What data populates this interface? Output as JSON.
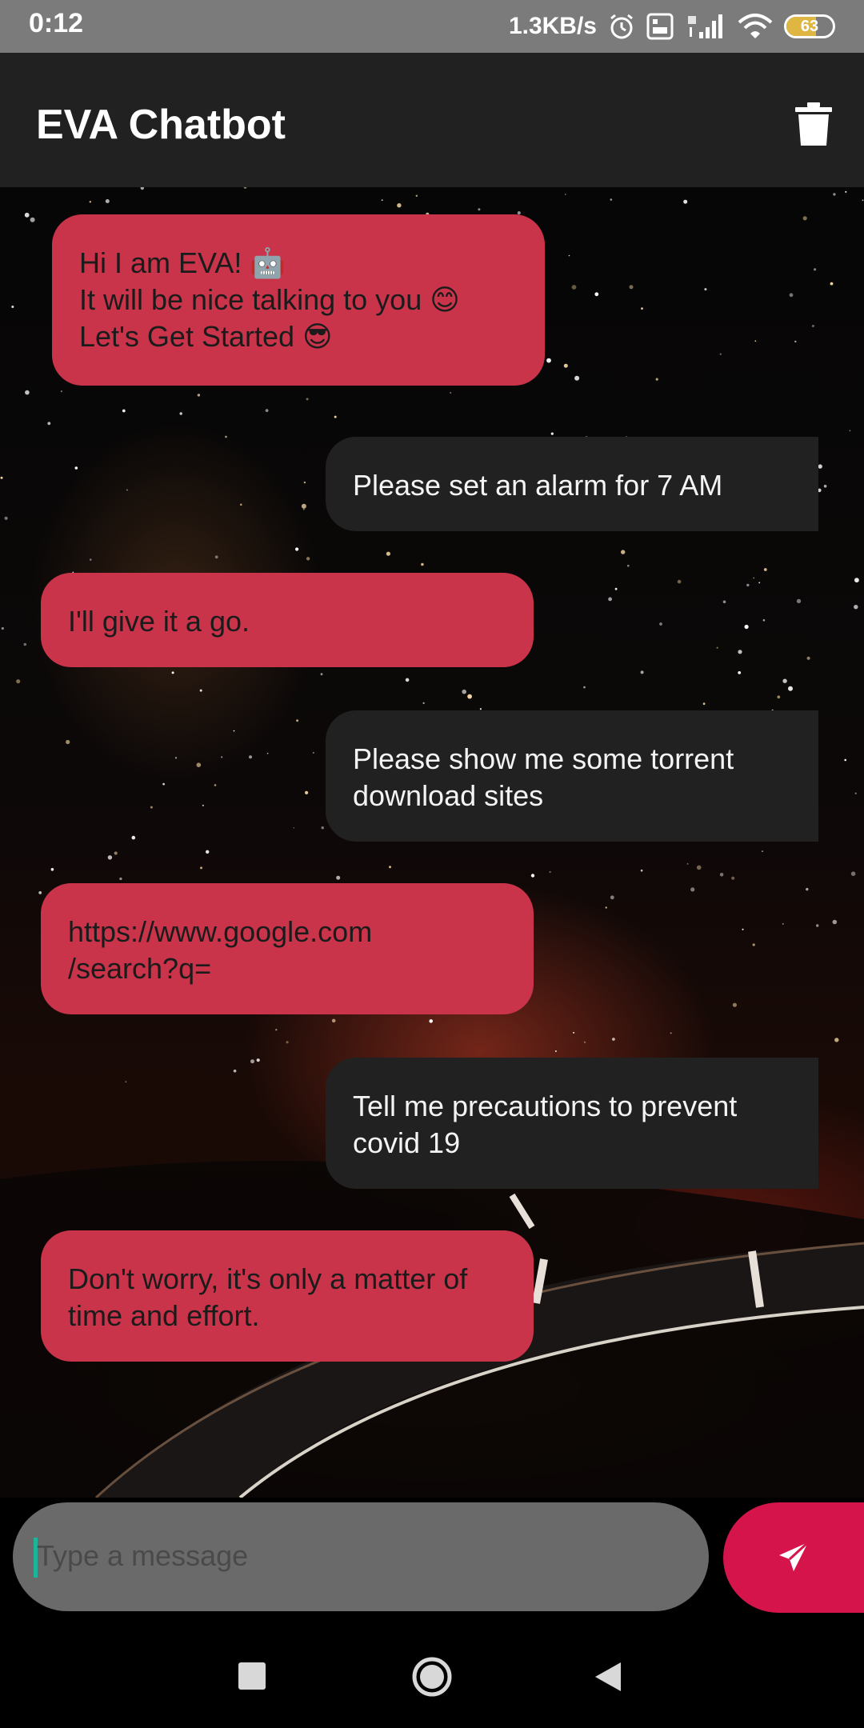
{
  "status_bar": {
    "time": "0:12",
    "network_speed": "1.3KB/s",
    "battery_level": "63",
    "battery_fraction": 0.63,
    "icons": [
      "alarm-icon",
      "volte-icon",
      "4g-signal-icon",
      "wifi-icon",
      "battery-icon"
    ]
  },
  "app_bar": {
    "title": "EVA Chatbot",
    "action_icon": "trash-icon"
  },
  "messages": [
    {
      "sender": "bot",
      "text": "Hi I am EVA! 🤖\n It will be nice talking to you 😊\nLet's Get Started 😎"
    },
    {
      "sender": "user",
      "text": "Please set an alarm for 7 AM"
    },
    {
      "sender": "bot",
      "text": "I'll give it a go."
    },
    {
      "sender": "user",
      "text": "Please show me some torrent\ndownload sites"
    },
    {
      "sender": "bot",
      "text": "https://www.google.com\n/search?q="
    },
    {
      "sender": "user",
      "text": "Tell me precautions to prevent\ncovid 19"
    },
    {
      "sender": "bot",
      "text": "Don't worry, it's only a matter of\ntime and effort."
    }
  ],
  "composer": {
    "placeholder": "Type a message",
    "value": "",
    "send_icon": "send-icon"
  },
  "nav_bar": {
    "icons": [
      "recents-icon",
      "home-icon",
      "back-icon"
    ]
  },
  "colors": {
    "bot_bubble": "#c9344a",
    "user_bubble": "#212121",
    "app_bar": "#212121",
    "status_bar": "#7b7b7b",
    "send_button": "#d4144a",
    "input_field": "#6a6a6a"
  }
}
